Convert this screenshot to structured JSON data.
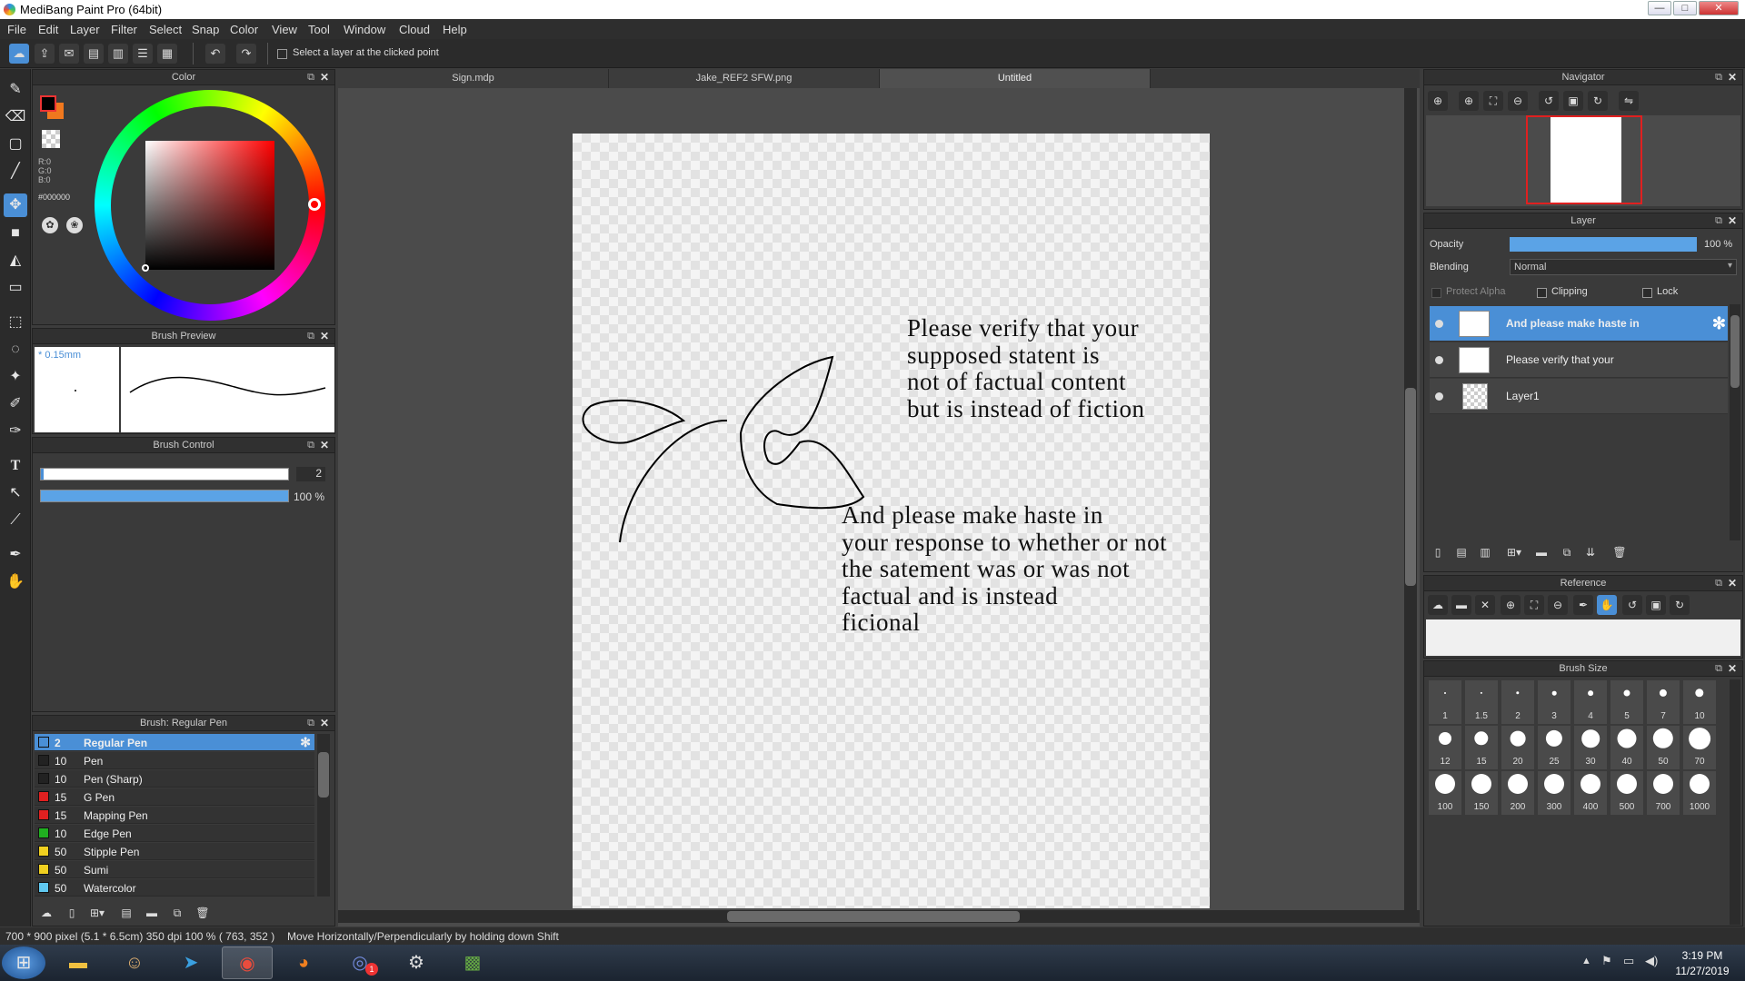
{
  "window": {
    "title": "MediBang Paint Pro (64bit)",
    "minimize": "—",
    "maximize": "□",
    "close": "✕"
  },
  "menu": [
    "File",
    "Edit",
    "Layer",
    "Filter",
    "Select",
    "Snap",
    "Color",
    "View",
    "Tool",
    "Window",
    "Cloud",
    "Help"
  ],
  "toolbar": {
    "select_layer_label": "Select a layer at the clicked point"
  },
  "doc_tabs": [
    "Sign.mdp",
    "Jake_REF2 SFW.png",
    "Untitled"
  ],
  "color_panel": {
    "title": "Color",
    "r": "R:0",
    "g": "G:0",
    "b": "B:0",
    "hex": "#000000"
  },
  "brush_preview": {
    "title": "Brush Preview",
    "size": "* 0.15mm"
  },
  "brush_control": {
    "title": "Brush Control",
    "size_value": "2",
    "opacity_value": "100 %",
    "opacity_fraction": 1.0
  },
  "brush_list": {
    "title": "Brush: Regular Pen",
    "items": [
      {
        "size": "2",
        "name": "Regular Pen",
        "color": "#4a8fd6",
        "selected": true
      },
      {
        "size": "10",
        "name": "Pen",
        "color": "#222222"
      },
      {
        "size": "10",
        "name": "Pen (Sharp)",
        "color": "#222222"
      },
      {
        "size": "15",
        "name": "G Pen",
        "color": "#e02020"
      },
      {
        "size": "15",
        "name": "Mapping Pen",
        "color": "#e02020"
      },
      {
        "size": "10",
        "name": "Edge Pen",
        "color": "#20b020"
      },
      {
        "size": "50",
        "name": "Stipple Pen",
        "color": "#f0d020"
      },
      {
        "size": "50",
        "name": "Sumi",
        "color": "#f0d020"
      },
      {
        "size": "50",
        "name": "Watercolor",
        "color": "#60c8f0"
      }
    ]
  },
  "canvas_text": {
    "block1": "Please verify that your\nsupposed statent is\nnot of factual content\nbut is instead of fiction",
    "block2": "And please make haste in\nyour response to whether or not\nthe satement was or was not\nfactual and is instead\nficional"
  },
  "navigator": {
    "title": "Navigator"
  },
  "layer_panel": {
    "title": "Layer",
    "opacity_label": "Opacity",
    "opacity_value": "100 %",
    "opacity_fraction": 1.0,
    "blending_label": "Blending",
    "blending_value": "Normal",
    "protect_alpha": "Protect Alpha",
    "clipping": "Clipping",
    "lock": "Lock",
    "layers": [
      {
        "name": "And please make haste in",
        "selected": true
      },
      {
        "name": "Please verify that your"
      },
      {
        "name": "Layer1"
      }
    ]
  },
  "reference": {
    "title": "Reference"
  },
  "brush_size": {
    "title": "Brush Size",
    "sizes": [
      "1",
      "1.5",
      "2",
      "3",
      "4",
      "5",
      "7",
      "10",
      "12",
      "15",
      "20",
      "25",
      "30",
      "40",
      "50",
      "70",
      "100",
      "150",
      "200",
      "300",
      "400",
      "500",
      "700",
      "1000"
    ]
  },
  "status": {
    "dims": "700 * 900 pixel   (5.1 * 6.5cm)   350 dpi   100 %   ( 763, 352 )",
    "hint": "Move Horizontally/Perpendicularly by holding down Shift"
  },
  "taskbar": {
    "time": "3:19 PM",
    "date": "11/27/2019",
    "discord_badge": "1"
  }
}
